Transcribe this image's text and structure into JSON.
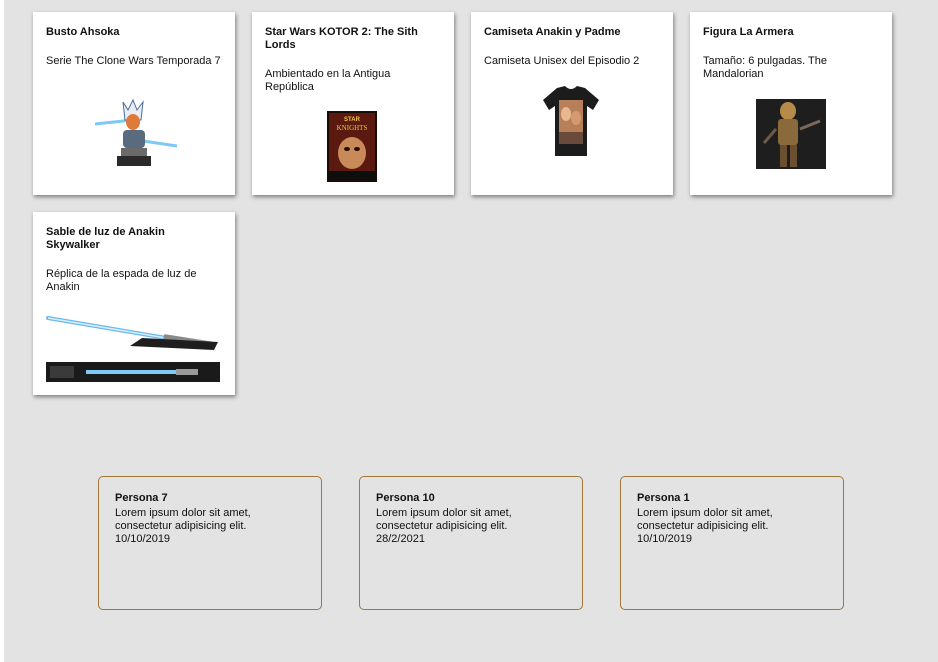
{
  "products": [
    {
      "title": "Busto Ahsoka",
      "description": "Serie The Clone Wars Temporada 7",
      "image_icon": "ahsoka-bust-image"
    },
    {
      "title": "Star Wars KOTOR 2: The Sith Lords",
      "description": "Ambientado en la Antigua República",
      "image_icon": "kotor2-cover-image",
      "cover_text": "KNIGHTS"
    },
    {
      "title": "Camiseta Anakin y Padme",
      "description": "Camiseta Unisex del Episodio 2",
      "image_icon": "tshirt-image"
    },
    {
      "title": "Figura La Armera",
      "description": "Tamaño: 6 pulgadas. The Mandalorian",
      "image_icon": "armorer-figure-image"
    },
    {
      "title": "Sable de luz de Anakin Skywalker",
      "description": "Réplica de la espada de luz de Anakin",
      "image_icon": "lightsaber-image"
    }
  ],
  "reviews": [
    {
      "name": "Persona 7",
      "text": "Lorem ipsum dolor sit amet, consectetur adipisicing elit.",
      "date": "10/10/2019"
    },
    {
      "name": "Persona 10",
      "text": "Lorem ipsum dolor sit amet, consectetur adipisicing elit.",
      "date": "28/2/2021"
    },
    {
      "name": "Persona 1",
      "text": "Lorem ipsum dolor sit amet, consectetur adipisicing elit.",
      "date": "10/10/2019"
    }
  ],
  "colors": {
    "background": "#e3e3e3",
    "card": "#ffffff",
    "review_border": "#a07838"
  }
}
